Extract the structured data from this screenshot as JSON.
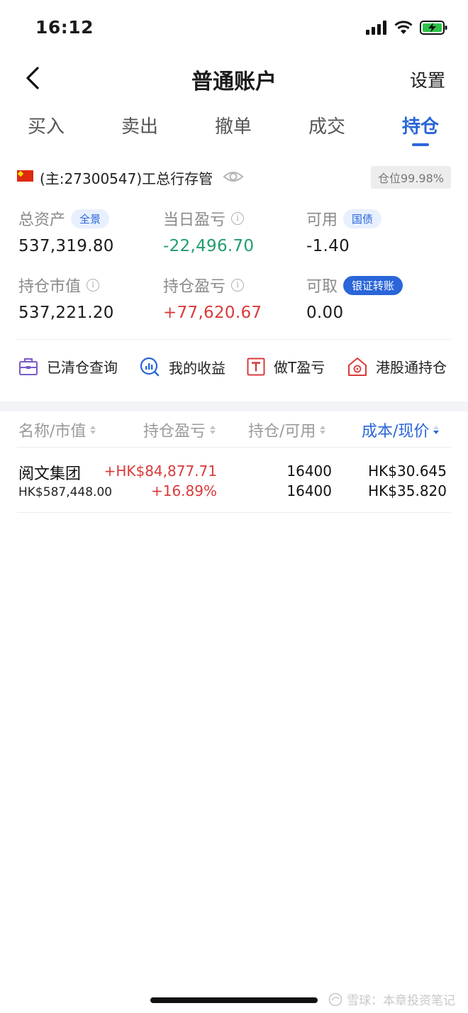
{
  "status_bar": {
    "time": "16:12"
  },
  "nav": {
    "title": "普通账户",
    "settings": "设置"
  },
  "tabs": [
    {
      "label": "买入"
    },
    {
      "label": "卖出"
    },
    {
      "label": "撤单"
    },
    {
      "label": "成交"
    },
    {
      "label": "持仓"
    }
  ],
  "active_tab": "持仓",
  "account": {
    "name": "(主:27300547)工总行存管",
    "position_ratio": "仓位99.98%"
  },
  "stats": {
    "total_assets": {
      "label": "总资产",
      "value": "537,319.80",
      "pill": "全景"
    },
    "daily_pnl": {
      "label": "当日盈亏",
      "value": "-22,496.70"
    },
    "available": {
      "label": "可用",
      "value": "-1.40",
      "pill": "国债"
    },
    "market_value": {
      "label": "持仓市值",
      "value": "537,221.20"
    },
    "position_pnl": {
      "label": "持仓盈亏",
      "value": "+77,620.67"
    },
    "withdrawable": {
      "label": "可取",
      "value": "0.00",
      "pill": "银证转账"
    }
  },
  "shortcuts": [
    {
      "label": "已清仓查询",
      "icon": "briefcase-icon"
    },
    {
      "label": "我的收益",
      "icon": "chart-search-icon"
    },
    {
      "label": "做T盈亏",
      "icon": "t-box-icon"
    },
    {
      "label": "港股通持仓",
      "icon": "hk-flower-icon"
    }
  ],
  "table": {
    "headers": {
      "name_value": "名称/市值",
      "pnl": "持仓盈亏",
      "holding_available": "持仓/可用",
      "cost_price": "成本/现价"
    },
    "rows": [
      {
        "name": "阅文集团",
        "market_value": "HK$587,448.00",
        "pnl_amount": "+HK$84,877.71",
        "pnl_percent": "+16.89%",
        "holding": "16400",
        "available": "16400",
        "cost": "HK$30.645",
        "price": "HK$35.820"
      }
    ]
  },
  "watermark": "雪球：本章投资笔记",
  "colors": {
    "accent": "#2a66d9",
    "gain": "#d93a3a",
    "loss": "#1f9e6b"
  }
}
